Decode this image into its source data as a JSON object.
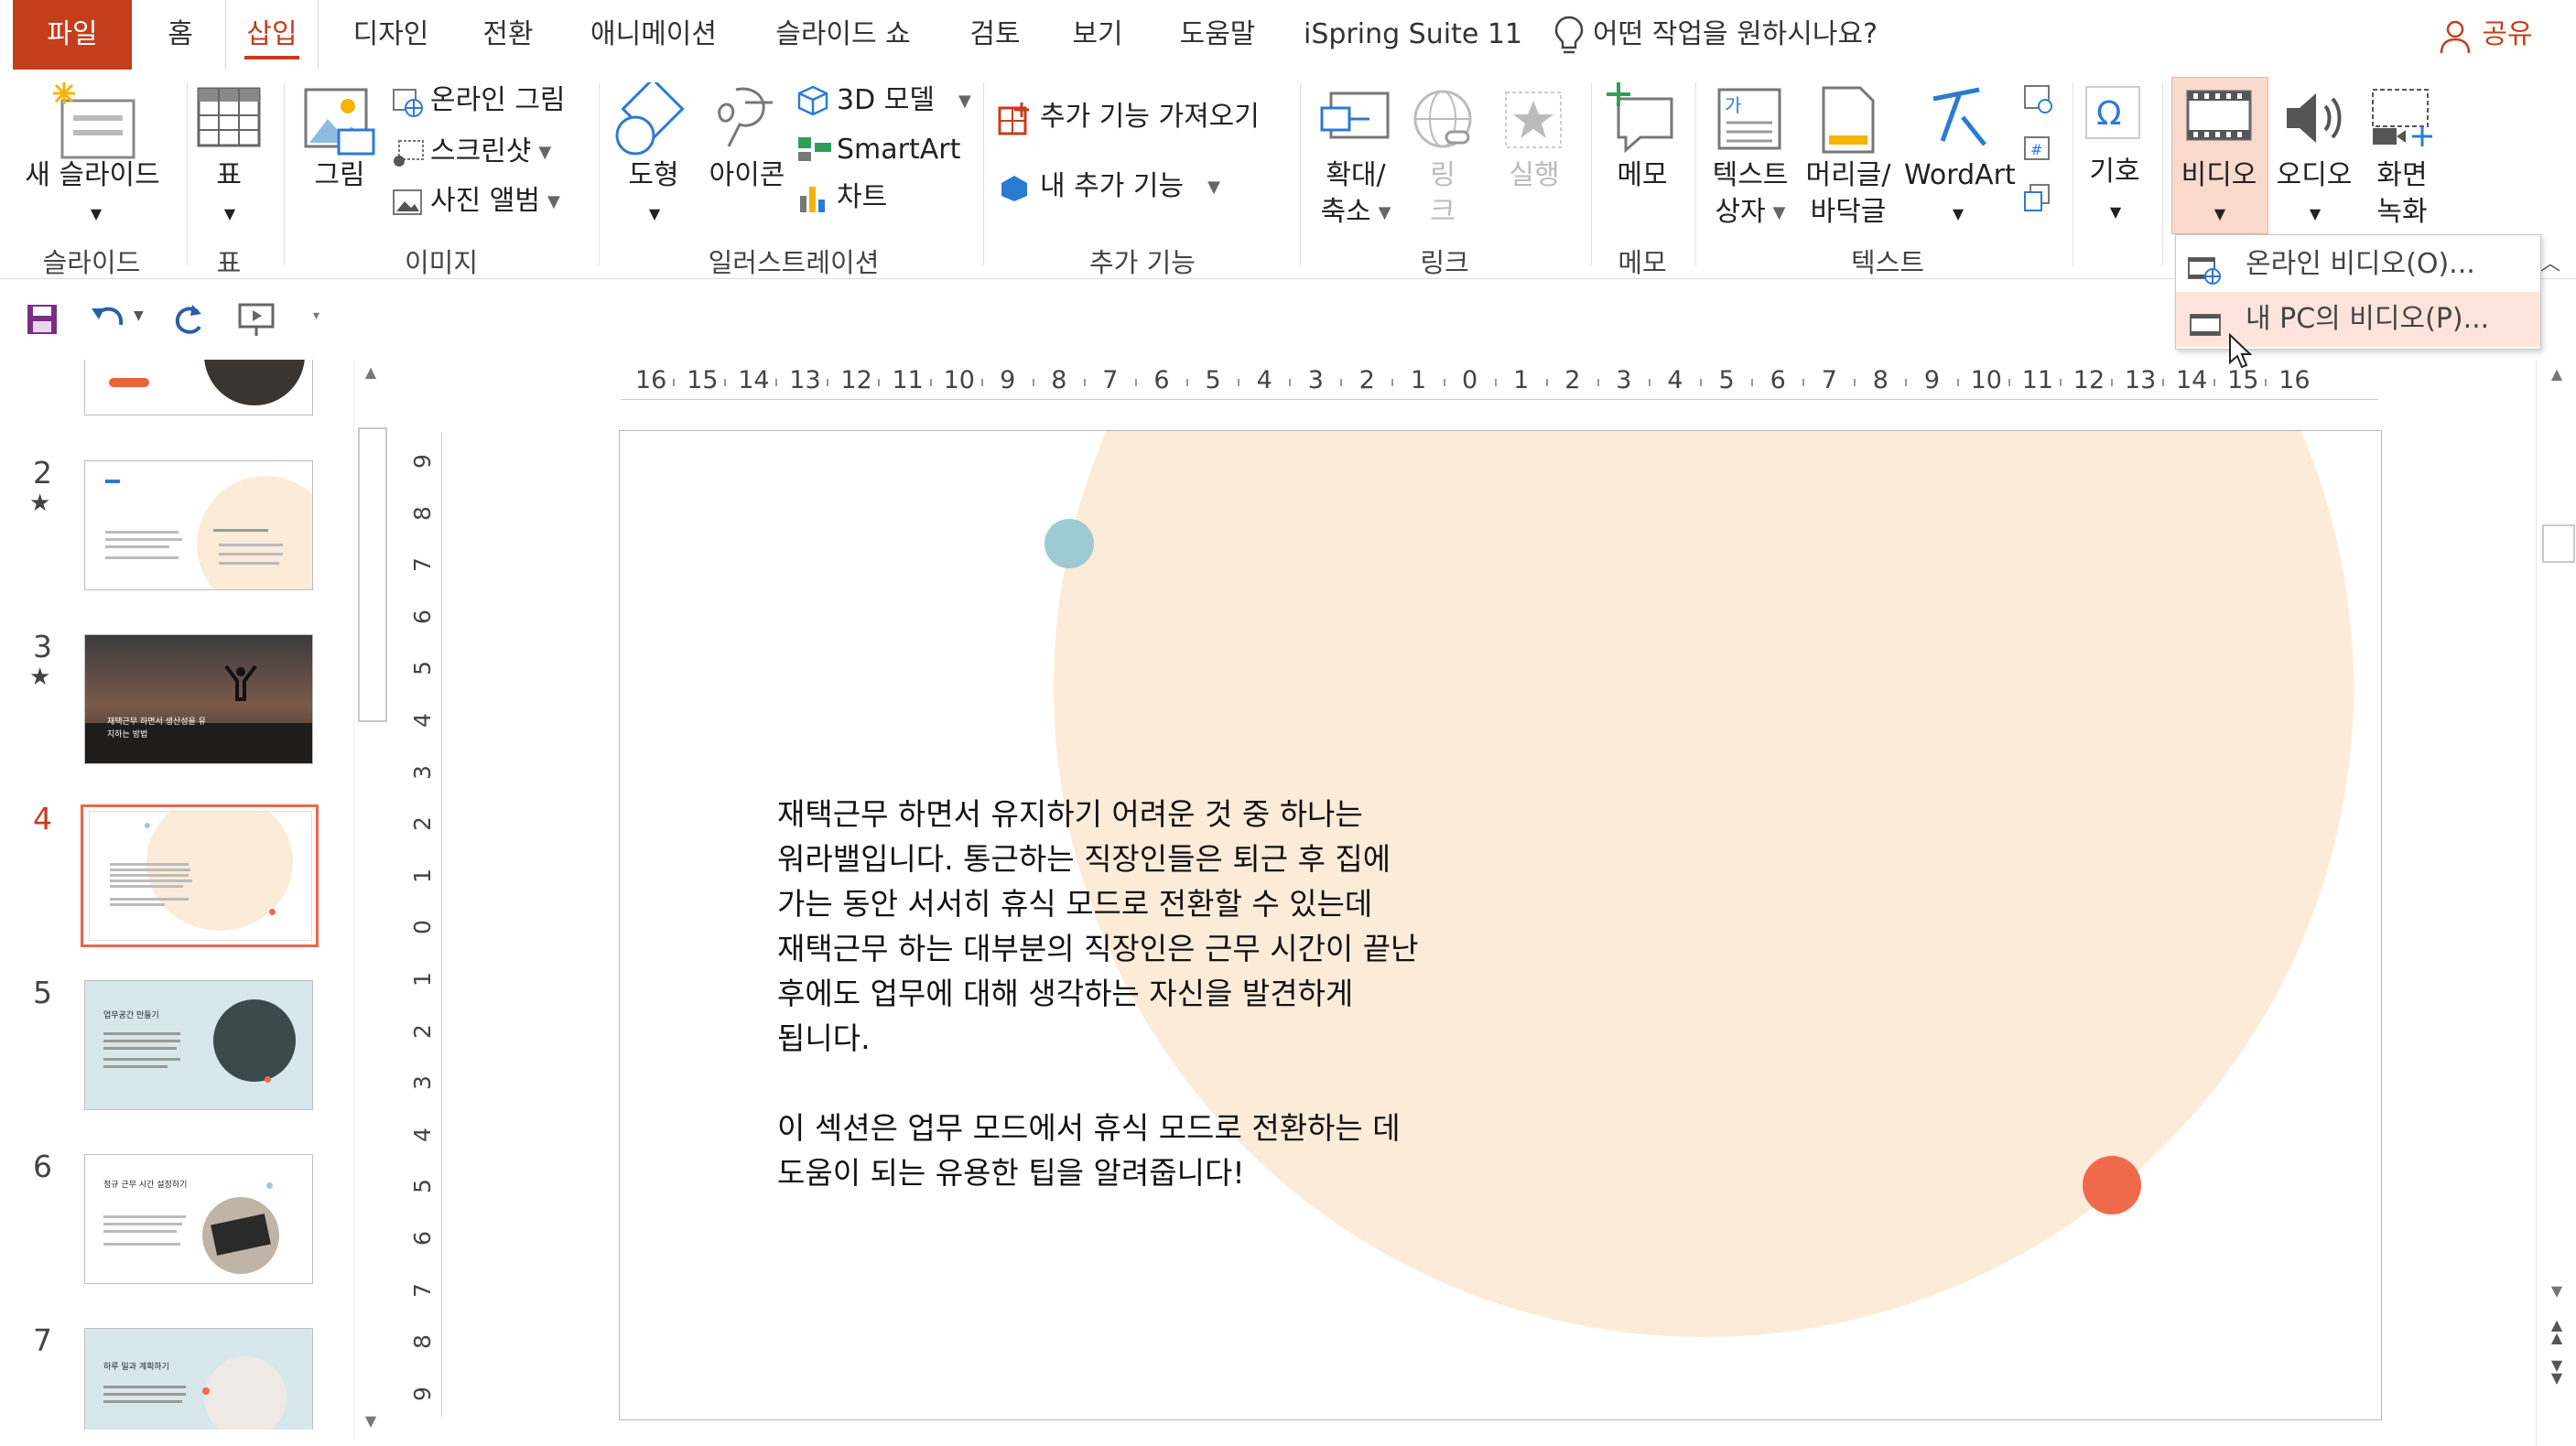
{
  "tabs": {
    "file": "파일",
    "home": "홈",
    "insert": "삽입",
    "design": "디자인",
    "transitions": "전환",
    "animations": "애니메이션",
    "slideshow": "슬라이드 쇼",
    "review": "검토",
    "view": "보기",
    "help": "도움말",
    "ispring": "iSpring Suite 11",
    "tell_me": "어떤 작업을 원하시나요?",
    "share": "공유"
  },
  "ribbon": {
    "new_slide": "새 슬라이드",
    "table": "표",
    "picture": "그림",
    "online_picture": "온라인 그림",
    "screenshot": "스크린샷",
    "photo_album": "사진 앨범",
    "shapes": "도형",
    "icons": "아이콘",
    "model3d": "3D 모델",
    "smartart": "SmartArt",
    "chart": "차트",
    "get_addins": "추가 기능 가져오기",
    "my_addins": "내 추가 기능",
    "zoom_1": "확대/",
    "zoom_2": "축소",
    "link_1": "링",
    "link_2": "크",
    "action": "실행",
    "comment": "메모",
    "textbox_1": "텍스트",
    "textbox_2": "상자",
    "header_1": "머리글/",
    "header_2": "바닥글",
    "wordart": "WordArt",
    "symbols": "기호",
    "video": "비디오",
    "audio": "오디오",
    "screen_rec_1": "화면",
    "screen_rec_2": "녹화",
    "groups": {
      "slides": "슬라이드",
      "tables": "표",
      "images": "이미지",
      "illustrations": "일러스트레이션",
      "addins": "추가 기능",
      "links": "링크",
      "comments": "메모",
      "text": "텍스트"
    }
  },
  "video_menu": {
    "online": "온라인 비디오(O)...",
    "pc": "내 PC의 비디오(P)..."
  },
  "thumbnails": [
    {
      "num": "2",
      "star": "★"
    },
    {
      "num": "3",
      "star": "★",
      "title": "재택근무 하면서 생산성을 유지하는 방법"
    },
    {
      "num": "4",
      "star": ""
    },
    {
      "num": "5",
      "star": "",
      "title": "업무공간 만들기"
    },
    {
      "num": "6",
      "star": "",
      "title": "정규 근무 시간 설정하기"
    },
    {
      "num": "7",
      "star": "",
      "title": "하루 일과 계획하기"
    }
  ],
  "ruler_h": [
    "16",
    "15",
    "14",
    "13",
    "12",
    "11",
    "10",
    "9",
    "8",
    "7",
    "6",
    "5",
    "4",
    "3",
    "2",
    "1",
    "0",
    "1",
    "2",
    "3",
    "4",
    "5",
    "6",
    "7",
    "8",
    "9",
    "10",
    "11",
    "12",
    "13",
    "14",
    "15",
    "16"
  ],
  "ruler_v": [
    "9",
    "8",
    "7",
    "6",
    "5",
    "4",
    "3",
    "2",
    "1",
    "0",
    "1",
    "2",
    "3",
    "4",
    "5",
    "6",
    "7",
    "8",
    "9"
  ],
  "slide": {
    "para1": [
      "재택근무 하면서 유지하기 어려운 것 중 하나는",
      "워라밸입니다. 통근하는 직장인들은 퇴근 후 집에",
      "가는 동안 서서히 휴식 모드로 전환할 수 있는데",
      "재택근무 하는 대부분의 직장인은 근무 시간이 끝난",
      "후에도 업무에 대해 생각하는 자신을 발견하게",
      "됩니다."
    ],
    "para2": [
      "이 섹션은 업무 모드에서 휴식 모드로 전환하는 데",
      "도움이 되는 유용한 팁을 알려줍니다!"
    ]
  },
  "colors": {
    "accent": "#c43e1c",
    "peach": "#fcebd8",
    "dot_teal": "#9dcad3",
    "dot_orange": "#ef6a4a",
    "thumb_bg_blue": "#d6e8ec"
  }
}
